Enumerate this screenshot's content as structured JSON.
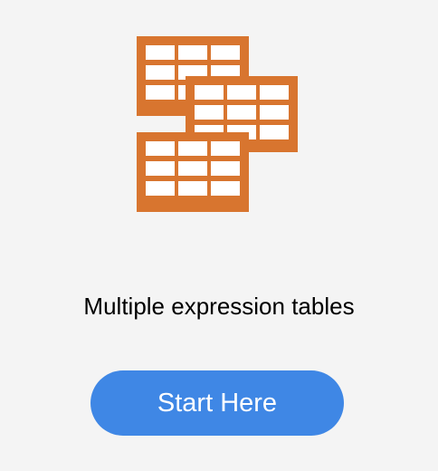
{
  "card": {
    "icon": "multiple-tables-icon",
    "title": "Multiple expression tables",
    "button_label": "Start Here"
  },
  "colors": {
    "background": "#f4f4f4",
    "icon": "#d8752f",
    "button": "#3f87e5",
    "button_text": "#ffffff",
    "title_text": "#000000"
  }
}
